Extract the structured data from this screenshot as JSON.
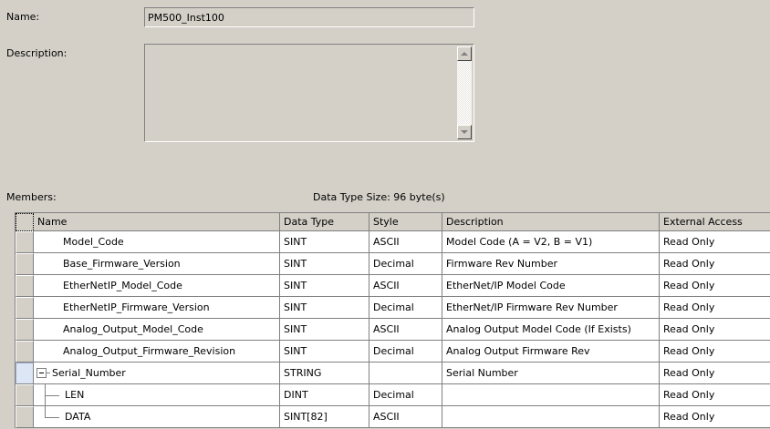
{
  "form": {
    "name_label": "Name:",
    "name_value": "PM500_Inst100",
    "description_label": "Description:",
    "description_value": "",
    "members_label": "Members:",
    "data_type_size": "Data Type Size: 96 byte(s)"
  },
  "table": {
    "headers": {
      "name": "Name",
      "data_type": "Data Type",
      "style": "Style",
      "description": "Description",
      "external_access": "External Access"
    },
    "rows": [
      {
        "name": "Model_Code",
        "data_type": "SINT",
        "style": "ASCII",
        "description": "Model Code (A = V2, B = V1)",
        "external_access": "Read Only"
      },
      {
        "name": "Base_Firmware_Version",
        "data_type": "SINT",
        "style": "Decimal",
        "description": "Firmware Rev Number",
        "external_access": "Read Only"
      },
      {
        "name": "EtherNetIP_Model_Code",
        "data_type": "SINT",
        "style": "ASCII",
        "description": "EtherNet/IP Model Code",
        "external_access": "Read Only"
      },
      {
        "name": "EtherNetIP_Firmware_Version",
        "data_type": "SINT",
        "style": "Decimal",
        "description": "EtherNet/IP Firmware Rev Number",
        "external_access": "Read Only"
      },
      {
        "name": "Analog_Output_Model_Code",
        "data_type": "SINT",
        "style": "ASCII",
        "description": "Analog Output Model Code (If Exists)",
        "external_access": "Read Only"
      },
      {
        "name": "Analog_Output_Firmware_Revision",
        "data_type": "SINT",
        "style": "Decimal",
        "description": "Analog Output Firmware Rev",
        "external_access": "Read Only"
      },
      {
        "name": "Serial_Number",
        "data_type": "STRING",
        "style": "",
        "description": "Serial Number",
        "external_access": "Read Only"
      },
      {
        "name": "LEN",
        "data_type": "DINT",
        "style": "Decimal",
        "description": "",
        "external_access": "Read Only"
      },
      {
        "name": "DATA",
        "data_type": "SINT[82]",
        "style": "ASCII",
        "description": "",
        "external_access": "Read Only"
      }
    ]
  },
  "colors": {
    "face": "#d4d0c8",
    "grid_line": "#808080",
    "selected_row_indicator": "#dde6f5"
  }
}
